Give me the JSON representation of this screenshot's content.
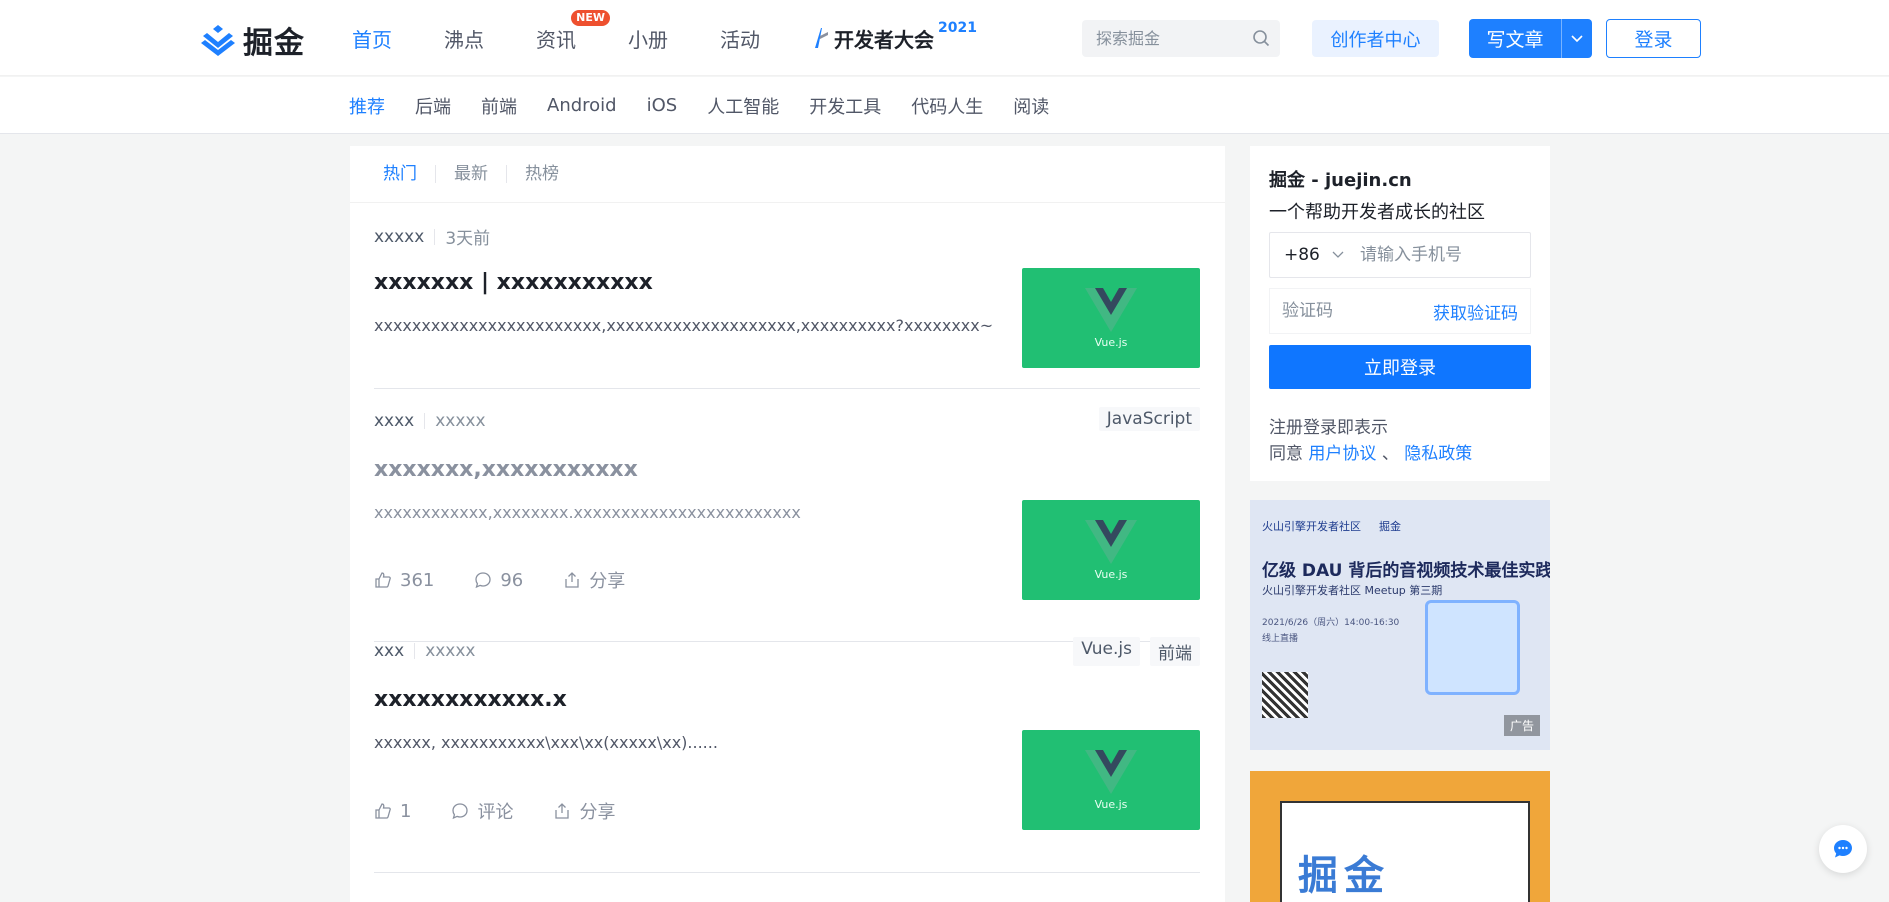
{
  "header": {
    "logo_text": "掘金",
    "nav": [
      {
        "label": "首页",
        "active": true
      },
      {
        "label": "沸点"
      },
      {
        "label": "资讯",
        "badge": "NEW"
      },
      {
        "label": "小册"
      },
      {
        "label": "活动"
      }
    ],
    "conference": {
      "label": "开发者大会",
      "year": "2021"
    },
    "search_placeholder": "探索掘金",
    "creator_center": "创作者中心",
    "write_article": "写文章",
    "login": "登录"
  },
  "subnav": [
    "推荐",
    "后端",
    "前端",
    "Android",
    "iOS",
    "人工智能",
    "开发工具",
    "代码人生",
    "阅读"
  ],
  "feed": {
    "tabs": [
      "热门",
      "最新",
      "热榜"
    ],
    "articles": [
      {
        "author": "xxxxx",
        "time": "3天前",
        "tags": [],
        "title": "xxxxxxx | xxxxxxxxxxx",
        "abstract": "xxxxxxxxxxxxxxxxxxxxxxxx,xxxxxxxxxxxxxxxxxxxx,xxxxxxxxxx?xxxxxxxx~",
        "thumb_label": "Vue.js"
      },
      {
        "author": "xxxx",
        "time": "xxxxx",
        "tags": [
          "JavaScript"
        ],
        "title": "xxxxxxx,xxxxxxxxxxx",
        "abstract": "xxxxxxxxxxxx,xxxxxxxx.xxxxxxxxxxxxxxxxxxxxxxxx",
        "likes": "361",
        "comments": "96",
        "share": "分享",
        "thumb_label": "Vue.js"
      },
      {
        "author": "xxx",
        "time": "xxxxx",
        "tags": [
          "Vue.js",
          "前端"
        ],
        "title": "xxxxxxxxxxxx.x",
        "abstract": "xxxxxx, xxxxxxxxxxx\\xxx\\xx(xxxxx\\xx)......",
        "likes": "1",
        "comments": "评论",
        "share": "分享",
        "thumb_label": "Vue.js"
      }
    ]
  },
  "login_card": {
    "title": "掘金 - juejin.cn",
    "subtitle": "一个帮助开发者成长的社区",
    "country_code": "+86",
    "phone_placeholder": "请输入手机号",
    "code_placeholder": "验证码",
    "get_code": "获取验证码",
    "submit": "立即登录",
    "agree_line1": "注册登录即表示",
    "agree_prefix": "同意",
    "user_agreement": "用户协议",
    "agree_sep": "、",
    "privacy_policy": "隐私政策"
  },
  "ad1": {
    "brand_left": "火山引擎开发者社区",
    "brand_right": "掘金",
    "headline": "亿级 DAU 背后的音视频技术最佳实践",
    "subline": "火山引擎开发者社区 Meetup 第三期",
    "date": "2021/6/26（周六）14:00-16:30",
    "live": "线上直播",
    "badge": "广告"
  },
  "ad2": {
    "text": "掘金"
  },
  "colors": {
    "accent": "#1e80ff",
    "thumb": "#21bf73",
    "background": "#f4f5f5"
  },
  "icons": [
    "search-icon",
    "chevron-down-icon",
    "like-icon",
    "comment-icon",
    "share-icon",
    "chat-icon"
  ]
}
